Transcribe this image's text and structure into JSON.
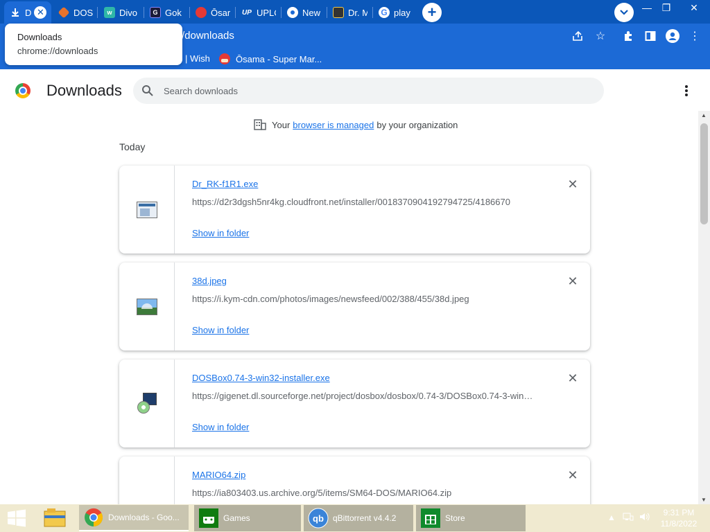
{
  "tabs": [
    {
      "label": "D",
      "icon": "download-icon",
      "active": true
    },
    {
      "label": "DOS",
      "icon": "dosbox-icon"
    },
    {
      "label": "Divo",
      "icon": "wish-icon"
    },
    {
      "label": "Gok",
      "icon": "gok-icon"
    },
    {
      "label": "Ōsar",
      "icon": "mario-icon"
    },
    {
      "label": "UPLO",
      "icon": "upload-icon"
    },
    {
      "label": "New",
      "icon": "chrome-icon"
    },
    {
      "label": "Dr. M",
      "icon": "drm-icon"
    },
    {
      "label": "play",
      "icon": "google-icon"
    }
  ],
  "hover_card": {
    "title": "Downloads",
    "url": "chrome://downloads"
  },
  "toolbar": {
    "url_visible": "/downloads"
  },
  "bookmarks": [
    {
      "label": "| Wish"
    },
    {
      "label": "Ōsama - Super Mar..."
    }
  ],
  "page": {
    "title": "Downloads",
    "search_placeholder": "Search downloads",
    "managed": {
      "prefix": "Your",
      "link": "browser is managed",
      "suffix": "by your organization"
    },
    "section": "Today",
    "show_in_folder": "Show in folder"
  },
  "downloads": [
    {
      "name": "Dr_RK-f1R1.exe",
      "url": "https://d2r3dgsh5nr4kg.cloudfront.net/installer/0018370904192794725/4186670",
      "icon": "exe-file-icon"
    },
    {
      "name": "38d.jpeg",
      "url": "https://i.kym-cdn.com/photos/images/newsfeed/002/388/455/38d.jpeg",
      "icon": "image-file-icon"
    },
    {
      "name": "DOSBox0.74-3-win32-installer.exe",
      "url": "https://gigenet.dl.sourceforge.net/project/dosbox/dosbox/0.74-3/DOSBox0.74-3-win…",
      "icon": "installer-file-icon"
    },
    {
      "name": "MARIO64.zip",
      "url": "https://ia803403.us.archive.org/5/items/SM64-DOS/MARIO64.zip",
      "icon": "zip-file-icon"
    }
  ],
  "taskbar": {
    "items": [
      {
        "label": "Downloads - Goo...",
        "icon": "chrome-icon"
      },
      {
        "label": "Games",
        "icon": "xbox-icon"
      },
      {
        "label": "qBittorrent v4.4.2",
        "icon": "qbittorrent-icon"
      },
      {
        "label": "Store",
        "icon": "store-icon"
      }
    ],
    "time": "9:31 PM",
    "date": "11/8/2022"
  },
  "colors": {
    "tabstrip": "#0b57b9",
    "toolbar": "#1c6ad6",
    "link": "#1a73e8",
    "taskbar": "#f0ead0"
  }
}
